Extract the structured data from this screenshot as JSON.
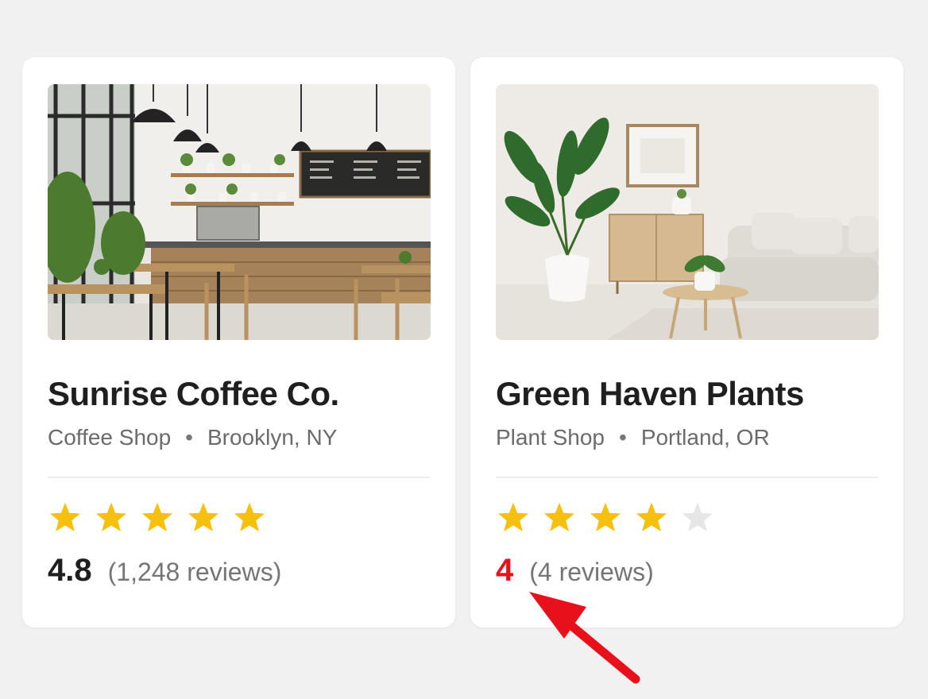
{
  "cards": [
    {
      "photo_subject": "cafe interior",
      "title": "Sunrise Coffee Co.",
      "category": "Coffee Shop",
      "separator": "•",
      "location": "Brooklyn, NY",
      "star_rating": 5,
      "score": "4.8",
      "reviews": "(1,248 reviews)"
    },
    {
      "photo_subject": "plant shop living room",
      "title": "Green Haven Plants",
      "category": "Plant Shop",
      "separator": "•",
      "location": "Portland, OR",
      "star_rating": 4,
      "score": "4",
      "reviews": "(4 reviews)"
    }
  ],
  "colors": {
    "star_filled": "#f5c10e",
    "star_empty": "#e6e6e6",
    "highlight": "#e8101b"
  },
  "annotation": {
    "type": "arrow",
    "points_to": "cards.1.score",
    "color": "#e8101b"
  }
}
